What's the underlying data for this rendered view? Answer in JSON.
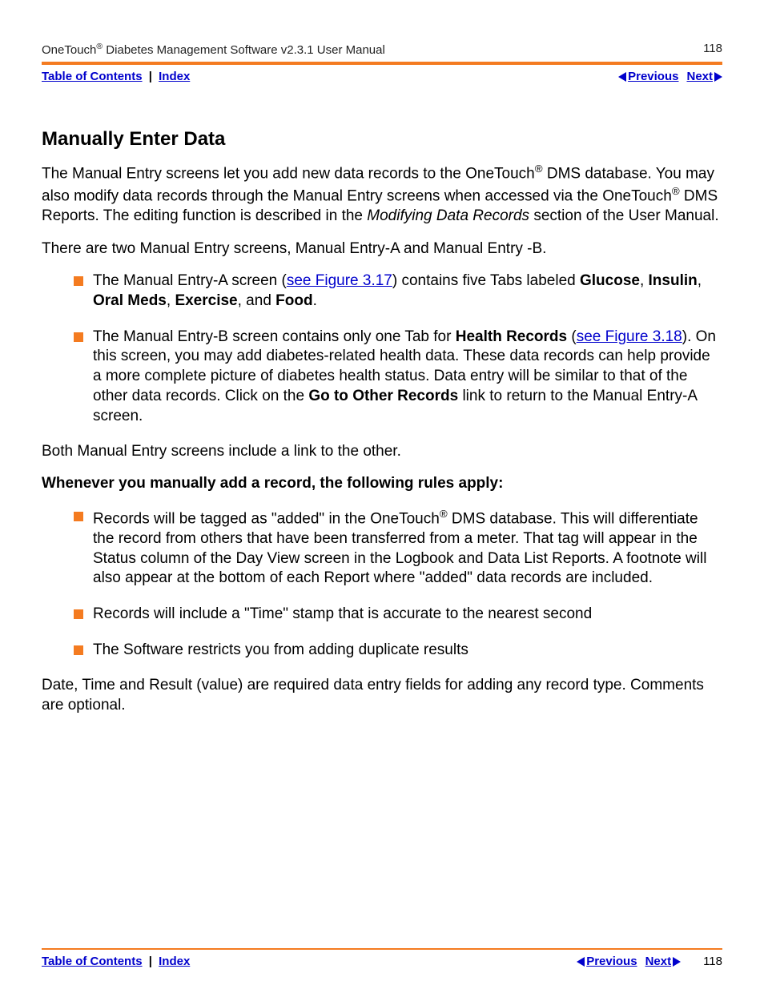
{
  "header": {
    "title_html": "OneTouch<span class='reg'>®</span> Diabetes Management Software v2.3.1 User Manual",
    "page_number": "118"
  },
  "nav": {
    "toc": "Table of Contents",
    "index": "Index",
    "prev": "Previous",
    "next": "Next"
  },
  "section": {
    "title": "Manually Enter Data",
    "p1_html": "The Manual Entry screens let you add new data records to the OneTouch<span class='reg'>®</span> DMS database. You may also modify data records through the Manual Entry screens when accessed via the OneTouch<span class='reg'>®</span> DMS Reports. The editing function is described in the <span class='italic'>Modifying Data Records</span> section of the User Manual.",
    "p2": "There are two Manual Entry screens, Manual Entry-A and Manual Entry -B.",
    "bullet1_html": "The Manual Entry-A screen (<a class='inline-link' data-name='figure-link-3-17' data-interactable='true'>see Figure 3.17</a>) contains five Tabs labeled <span class='bold'>Glucose</span>, <span class='bold'>Insulin</span>, <span class='bold'>Oral Meds</span>, <span class='bold'>Exercise</span>, and <span class='bold'>Food</span>.",
    "bullet2_html": "The Manual Entry-B screen contains only one Tab for <span class='bold'>Health Records</span> (<a class='inline-link' data-name='figure-link-3-18' data-interactable='true'>see Figure 3.18</a>). On this screen, you may add diabetes-related health data. These data records can help provide a more complete picture of diabetes health status. Data entry will be similar to that of the other data records. Click on the <span class='bold'>Go to Other Records</span> link to return to the Manual Entry-A screen.",
    "p3": "Both Manual Entry screens include a link to the other.",
    "rules_head": "Whenever you manually add a record, the following rules apply:",
    "rule1_html": "Records will be tagged as \"added\" in the OneTouch<span class='reg'>®</span> DMS database. This will differentiate the record from others that have been transferred from a meter. That tag will appear in the Status column of the Day View screen in the Logbook and Data List Reports. A footnote will also appear at the bottom of each Report where \"added\" data records are included.",
    "rule2": "Records will include a \"Time\" stamp that is accurate to the nearest second",
    "rule3": "The Software restricts you from adding duplicate results",
    "p4": "Date, Time and Result (value) are required data entry fields for adding any record type. Comments are optional."
  },
  "footer": {
    "page_number": "118"
  }
}
